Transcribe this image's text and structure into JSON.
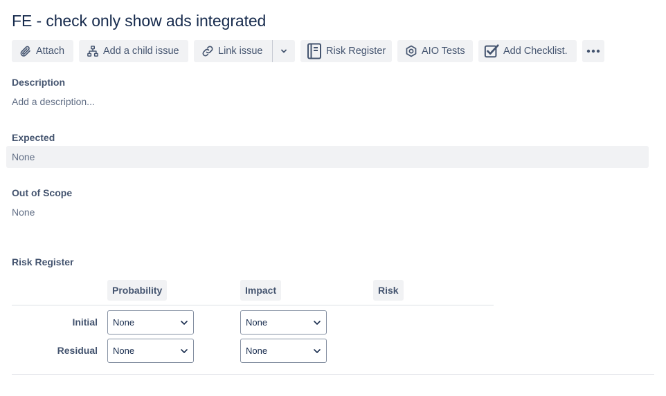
{
  "issue": {
    "title": "FE - check only show ads integrated"
  },
  "toolbar": {
    "attach": "Attach",
    "add_child": "Add a child issue",
    "link_issue": "Link issue",
    "risk_register": "Risk Register",
    "aio_tests": "AIO Tests",
    "add_checklist": "Add Checklist."
  },
  "fields": {
    "description": {
      "label": "Description",
      "placeholder": "Add a description..."
    },
    "expected": {
      "label": "Expected",
      "value": "None"
    },
    "out_of_scope": {
      "label": "Out of Scope",
      "value": "None"
    }
  },
  "risk_register": {
    "title": "Risk Register",
    "columns": [
      "Probability",
      "Impact",
      "Risk"
    ],
    "rows": [
      {
        "label": "Initial",
        "probability": "None",
        "impact": "None"
      },
      {
        "label": "Residual",
        "probability": "None",
        "impact": "None"
      }
    ]
  },
  "colors": {
    "text_primary": "#172b4d",
    "text_secondary": "#44546f",
    "button_bg": "#f1f2f4"
  }
}
